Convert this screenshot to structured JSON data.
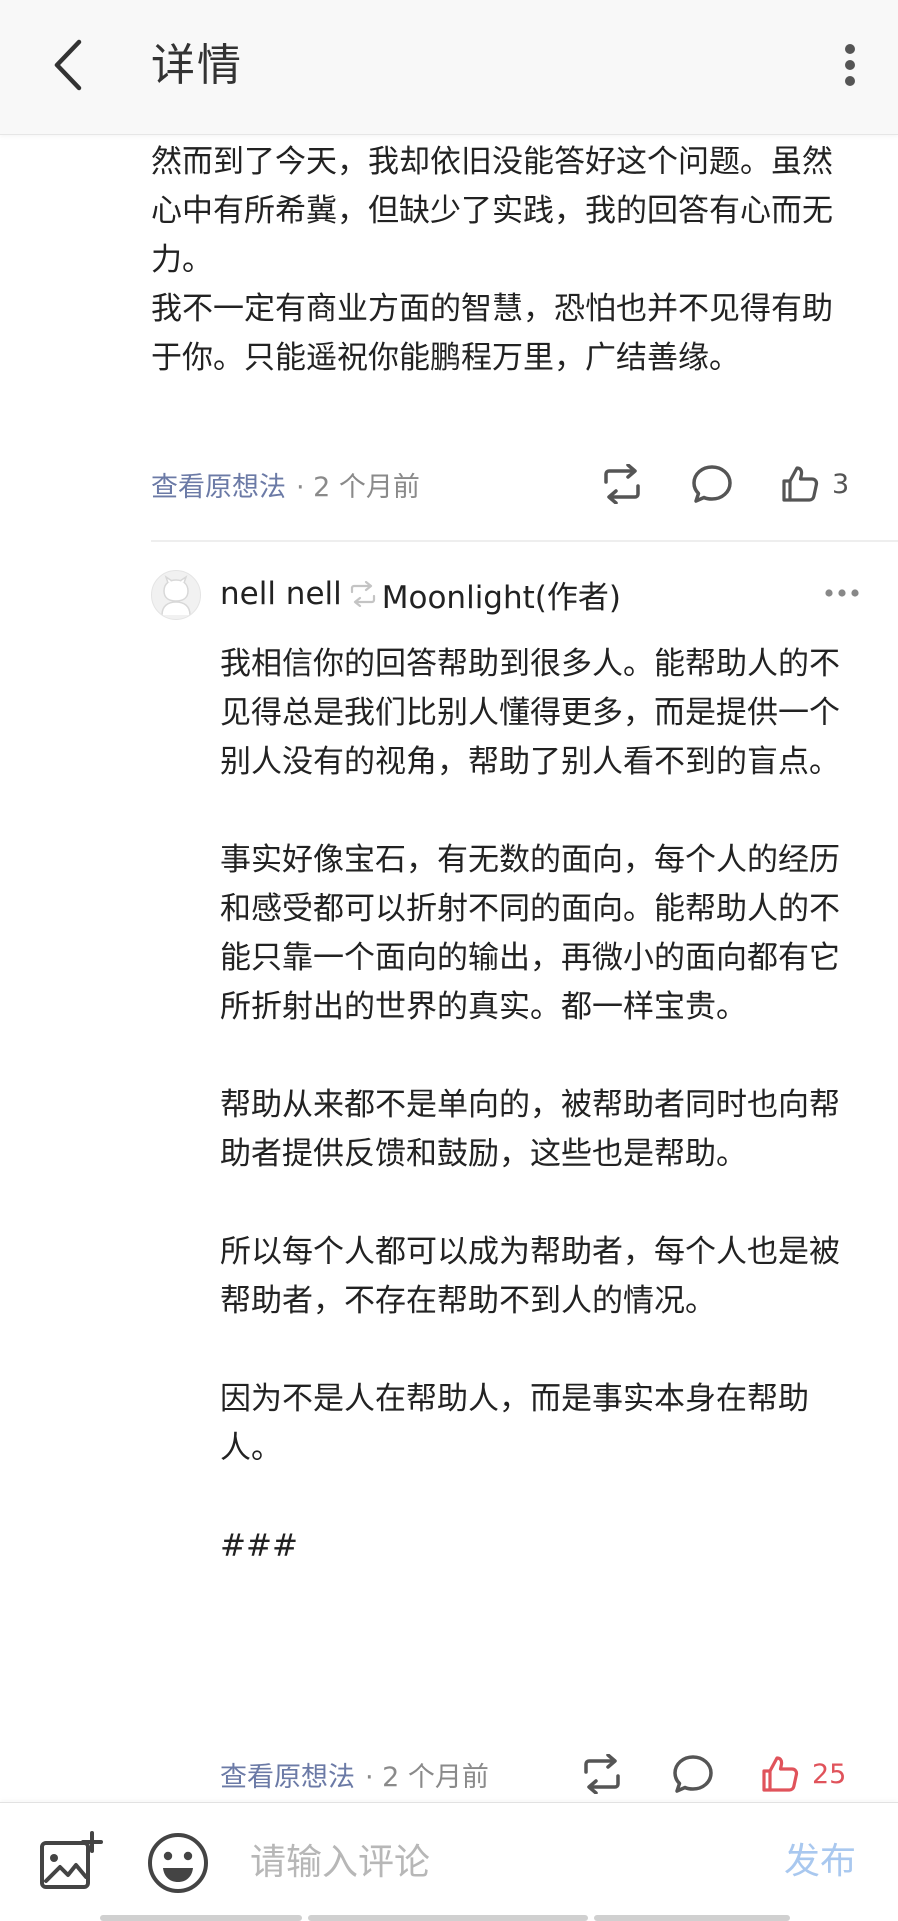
{
  "header": {
    "title": "详情"
  },
  "reply": {
    "text": "然而到了今天，我却依旧没能答好这个问题。虽然心中有所希冀，但缺少了实践，我的回答有心而无力。\n我不一定有商业方面的智慧，恐怕也并不见得有助于你。只能遥祝你能鹏程万里，广结善缘。",
    "view_original": "查看原想法",
    "time": "· 2 个月前",
    "like_count": "3"
  },
  "comment": {
    "author": "nell nell",
    "reply_to": "Moonlight(作者)",
    "text": "我相信你的回答帮助到很多人。能帮助人的不见得总是我们比别人懂得更多，而是提供一个别人没有的视角，帮助了别人看不到的盲点。\n\n事实好像宝石，有无数的面向，每个人的经历和感受都可以折射不同的面向。能帮助人的不能只靠一个面向的输出，再微小的面向都有它所折射出的世界的真实。都一样宝贵。\n\n帮助从来都不是单向的，被帮助者同时也向帮助者提供反馈和鼓励，这些也是帮助。\n\n所以每个人都可以成为帮助者，每个人也是被帮助者，不存在帮助不到人的情况。\n\n因为不是人在帮助人，而是事实本身在帮助人。\n\n###",
    "view_original": "查看原想法",
    "time": "· 2 个月前",
    "like_count": "25",
    "liked": true
  },
  "input": {
    "placeholder": "请输入评论",
    "publish_label": "发布"
  },
  "colors": {
    "link": "#6b7aa6",
    "like_active": "#e0535b",
    "publish_disabled": "#a9c8ef"
  },
  "icons": {
    "back": "chevron-left-icon",
    "more": "more-vertical-icon",
    "repost": "repost-icon",
    "comment": "comment-bubble-icon",
    "like": "thumbs-up-icon",
    "add_image": "add-image-icon",
    "emoji": "emoji-icon"
  }
}
